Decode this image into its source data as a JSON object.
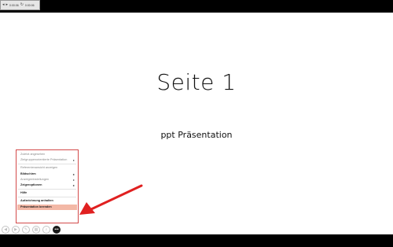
{
  "toolbar": {
    "items": [
      {
        "icon": "prev-icon",
        "glyph": "◂"
      },
      {
        "icon": "next-icon",
        "glyph": "▸"
      },
      {
        "label": "0:00:06"
      },
      {
        "icon": "reset-icon",
        "glyph": "↻"
      },
      {
        "label": "0:00:06"
      }
    ]
  },
  "slide": {
    "title": "Seite 1",
    "subtitle": "ppt Präsentation"
  },
  "context_menu": {
    "group1": [
      {
        "label": "Zuletzt angesehen",
        "submenu": false
      },
      {
        "label": "Zielgruppenorientierte Präsentation",
        "submenu": true
      }
    ],
    "group2": [
      {
        "label": "Referentenansicht anzeigen",
        "submenu": false
      },
      {
        "label": "Bildschirm",
        "submenu": true
      },
      {
        "label": "Anzeigeeinstellungen",
        "submenu": true
      },
      {
        "label": "Zeigeroptionen",
        "submenu": true
      }
    ],
    "group3": [
      {
        "label": "Hilfe",
        "submenu": false
      }
    ],
    "group4": [
      {
        "label": "Aufzeichnung anhalten",
        "submenu": false
      },
      {
        "label": "Präsentation beenden",
        "submenu": false
      }
    ]
  },
  "controls": [
    {
      "name": "previous-button",
      "glyph": "◀"
    },
    {
      "name": "next-button",
      "glyph": "▶"
    },
    {
      "name": "pen-tool-button",
      "glyph": "✎"
    },
    {
      "name": "all-slides-button",
      "glyph": "▦"
    },
    {
      "name": "zoom-button",
      "glyph": "⌕"
    },
    {
      "name": "more-options-button",
      "glyph": "•••"
    }
  ],
  "colors": {
    "menu_border": "#d34a4a",
    "highlight": "#f3b8a6",
    "arrow": "#e02020"
  }
}
